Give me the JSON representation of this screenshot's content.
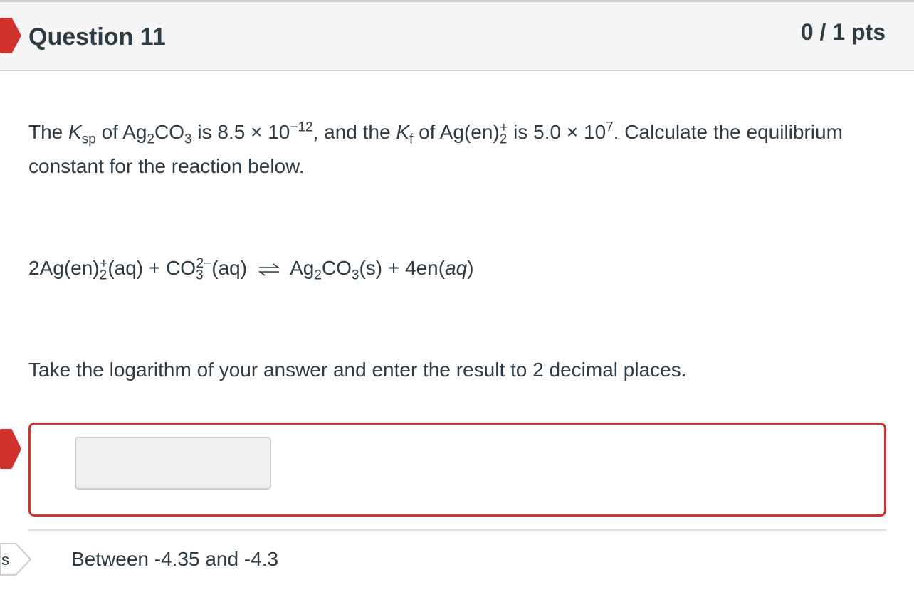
{
  "header": {
    "title": "Question 11",
    "points": "0 / 1 pts"
  },
  "question": {
    "t1": "The ",
    "ksp_k": "K",
    "ksp_sub": "sp",
    "t2": " of Ag",
    "ag2_sub": "2",
    "t3": "CO",
    "co3_sub": "3",
    "t4": " is 8.5 × 10",
    "exp1": "−12",
    "t5": ", and the ",
    "kf_k": "K",
    "kf_sub": "f",
    "t6": " of Ag(en)",
    "en_sub": "2",
    "en_sup": "+",
    "t7": " is 5.0 × 10",
    "exp2": "7",
    "t8": ".  Calculate the equilibrium constant for the reaction below."
  },
  "equation": {
    "a1": "2Ag(en)",
    "a1_sub": "2",
    "a1_sup": "+",
    "a2": "(aq) + CO",
    "a2_sub": "3",
    "a2_sup": "2−",
    "a3": "(aq)",
    "p1": "Ag",
    "p1_sub": "2",
    "p2": "CO",
    "p2_sub": "3",
    "p3": "(s) + 4en(",
    "p3_italic": "aq",
    "p4": ")"
  },
  "instruction": "Take the logarithm of your answer and enter the result to 2 decimal places.",
  "answer": {
    "value": "",
    "correct_label": "Between -4.35 and -4.3"
  },
  "colors": {
    "incorrect_red": "#d2322d",
    "text": "#2d3b45",
    "header_bg": "#f5f5f5"
  },
  "icons": {
    "header_flag": "incorrect-flag-icon",
    "answer_flag": "incorrect-answer-flag-icon",
    "correct_tag": "correct-answer-tag-icon"
  }
}
